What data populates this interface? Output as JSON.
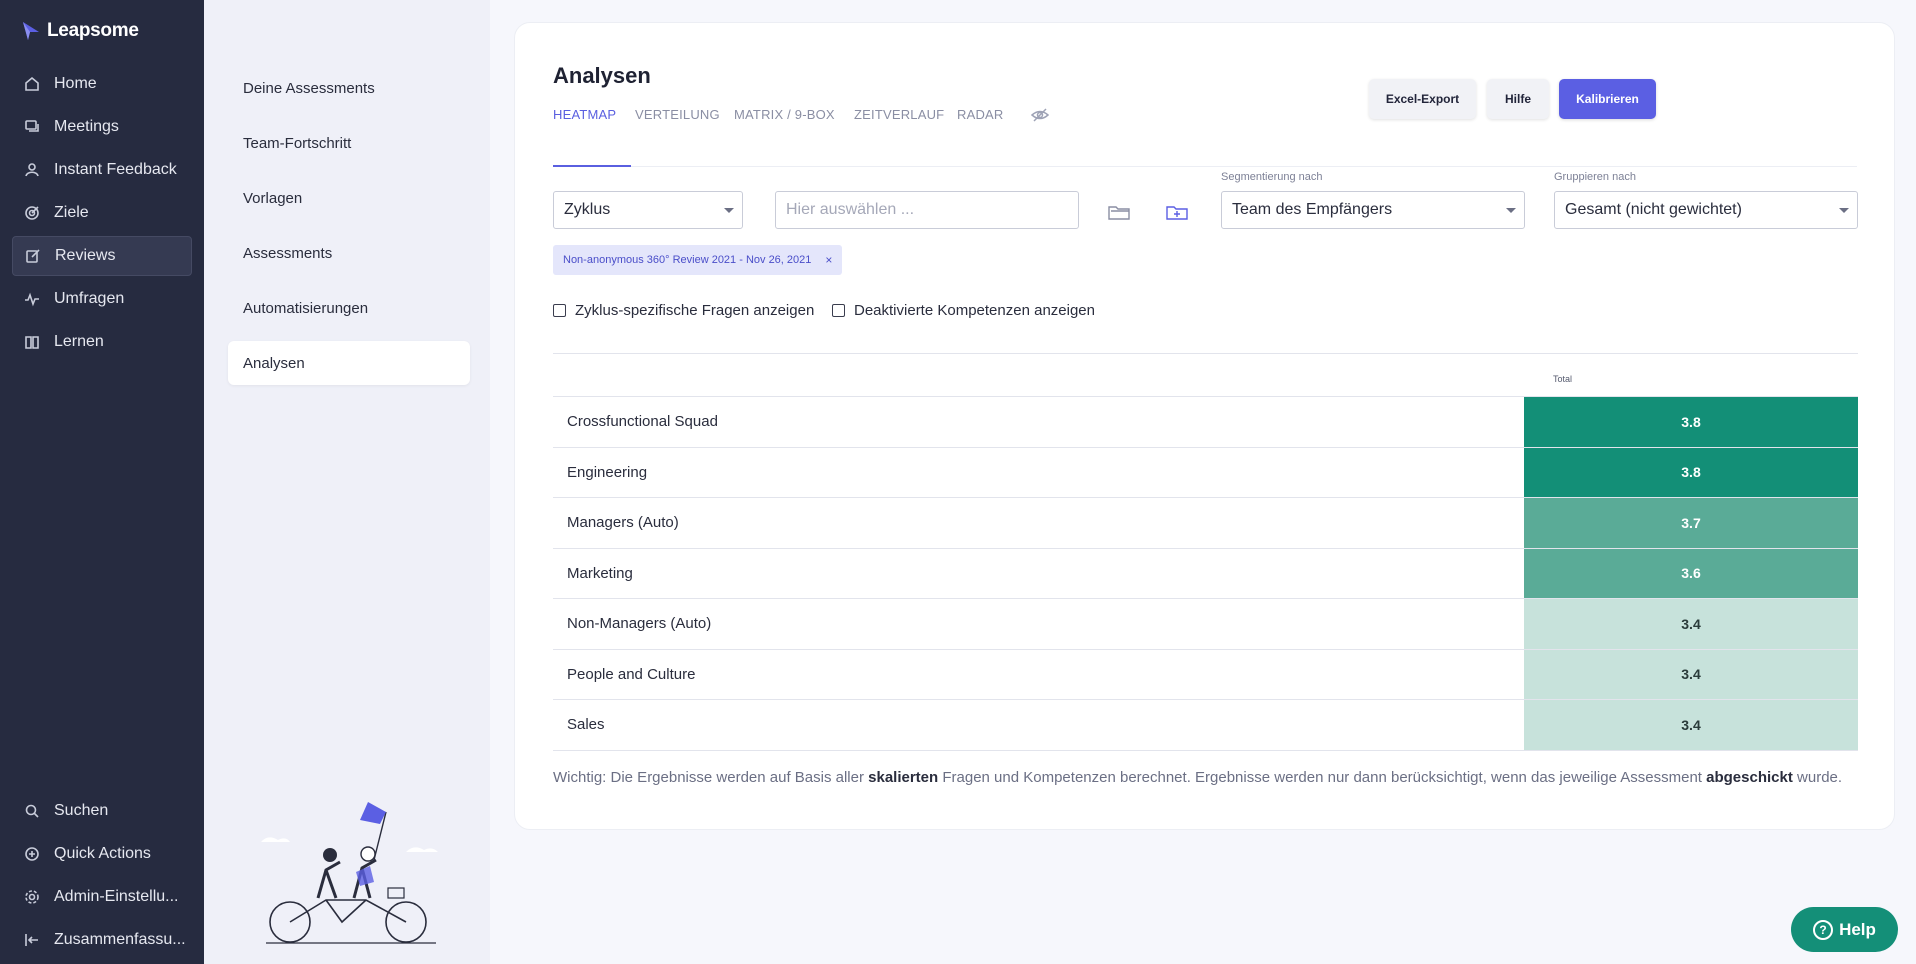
{
  "app": {
    "name": "Leapsome"
  },
  "nav": {
    "items": [
      {
        "label": "Home",
        "icon": "home-icon"
      },
      {
        "label": "Meetings",
        "icon": "chat-icon"
      },
      {
        "label": "Instant Feedback",
        "icon": "feedback-icon"
      },
      {
        "label": "Ziele",
        "icon": "target-icon"
      },
      {
        "label": "Reviews",
        "icon": "edit-icon",
        "active": true
      },
      {
        "label": "Umfragen",
        "icon": "pulse-icon"
      },
      {
        "label": "Lernen",
        "icon": "book-icon"
      }
    ],
    "bottom": [
      {
        "label": "Suchen",
        "icon": "search-icon"
      },
      {
        "label": "Quick Actions",
        "icon": "plus-circle-icon"
      },
      {
        "label": "Admin-Einstellu...",
        "icon": "gear-icon"
      },
      {
        "label": "Zusammenfassu...",
        "icon": "collapse-icon"
      }
    ]
  },
  "subnav": {
    "items": [
      {
        "label": "Deine Assessments"
      },
      {
        "label": "Team-Fortschritt"
      },
      {
        "label": "Vorlagen"
      },
      {
        "label": "Assessments"
      },
      {
        "label": "Automatisierungen"
      },
      {
        "label": "Analysen",
        "active": true
      }
    ]
  },
  "main": {
    "title": "Analysen",
    "tabs": [
      {
        "label": "HEATMAP",
        "active": true
      },
      {
        "label": "VERTEILUNG"
      },
      {
        "label": "MATRIX / 9-BOX"
      },
      {
        "label": "ZEITVERLAUF"
      },
      {
        "label": "RADAR"
      }
    ],
    "buttons": {
      "export": "Excel-Export",
      "help": "Hilfe",
      "calibrate": "Kalibrieren"
    },
    "filters": {
      "cycle_select": "Zyklus",
      "search_placeholder": "Hier auswählen ...",
      "segment_label": "Segmentierung nach",
      "segment_value": "Team des Empfängers",
      "group_label": "Gruppieren nach",
      "group_value": "Gesamt (nicht gewichtet)"
    },
    "chip": {
      "label": "Non-anonymous 360° Review 2021 - Nov 26, 2021",
      "close": "×"
    },
    "checkboxes": {
      "cycle_questions": "Zyklus-spezifische Fragen anzeigen",
      "disabled_competencies": "Deaktivierte Kompetenzen anzeigen"
    },
    "table": {
      "header": "Total",
      "rows": [
        {
          "label": "Crossfunctional Squad",
          "value": "3.8",
          "bg": "#138f77",
          "fg": "#ffffff"
        },
        {
          "label": "Engineering",
          "value": "3.8",
          "bg": "#138f77",
          "fg": "#ffffff"
        },
        {
          "label": "Managers (Auto)",
          "value": "3.7",
          "bg": "#5aab97",
          "fg": "#ffffff"
        },
        {
          "label": "Marketing",
          "value": "3.6",
          "bg": "#5aab97",
          "fg": "#ffffff"
        },
        {
          "label": "Non-Managers (Auto)",
          "value": "3.4",
          "bg": "#c7e2db",
          "fg": "#2a3b3a"
        },
        {
          "label": "People and Culture",
          "value": "3.4",
          "bg": "#c7e2db",
          "fg": "#2a3b3a"
        },
        {
          "label": "Sales",
          "value": "3.4",
          "bg": "#c7e2db",
          "fg": "#2a3b3a"
        }
      ]
    },
    "note": {
      "part1": "Wichtig: Die Ergebnisse werden auf Basis aller ",
      "bold1": "skalierten",
      "part2": " Fragen und Kompetenzen berechnet. Ergebnisse werden nur dann berücksichtigt, wenn das jeweilige Assessment ",
      "bold2": "abgeschickt",
      "part3": " wurde."
    }
  },
  "help_widget": {
    "label": "Help",
    "glyph": "?"
  },
  "colors": {
    "accent": "#5b5fe3",
    "nav_bg": "#262b40",
    "help_green": "#148f78"
  }
}
